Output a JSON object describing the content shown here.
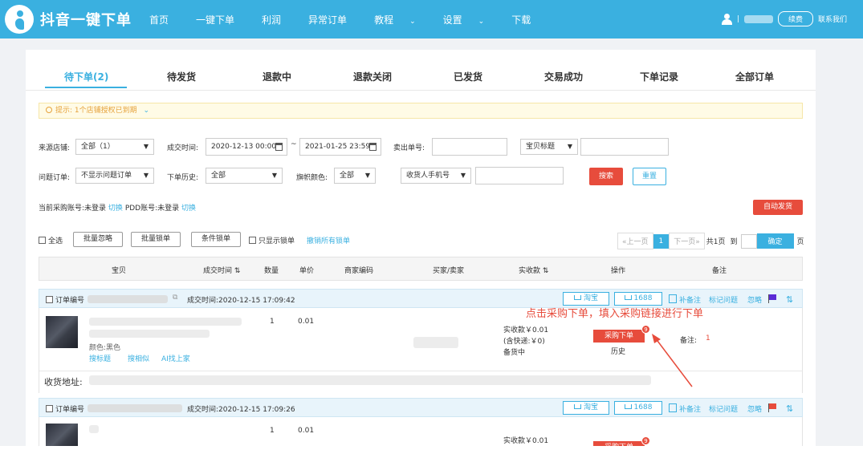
{
  "app": {
    "brand": "抖音一键下单"
  },
  "nav": [
    {
      "label": "首页",
      "dropdown": false
    },
    {
      "label": "一键下单",
      "dropdown": false
    },
    {
      "label": "利润",
      "dropdown": false
    },
    {
      "label": "异常订单",
      "dropdown": false
    },
    {
      "label": "教程",
      "dropdown": true
    },
    {
      "label": "设置",
      "dropdown": true
    },
    {
      "label": "下载",
      "dropdown": false
    }
  ],
  "user": {
    "separator": "|",
    "renew_label": "续费",
    "contact_label": "联系我们"
  },
  "tabs": [
    {
      "label": "待下单(2)",
      "active": true
    },
    {
      "label": "待发货",
      "active": false
    },
    {
      "label": "退款中",
      "active": false
    },
    {
      "label": "退款关闭",
      "active": false
    },
    {
      "label": "已发货",
      "active": false
    },
    {
      "label": "交易成功",
      "active": false
    },
    {
      "label": "下单记录",
      "active": false
    },
    {
      "label": "全部订单",
      "active": false
    }
  ],
  "tip": {
    "prefix": "提示:",
    "text": "1个店铺授权已到期"
  },
  "filters": {
    "shop_label": "来源店铺:",
    "shop_value": "全部（1）",
    "time_label": "成交时间:",
    "time_start": "2020-12-13 00:00",
    "time_sep": "~",
    "time_end": "2021-01-25 23:59",
    "sell_no_label": "卖出单号:",
    "title_select": "宝贝标题",
    "issue_label": "问题订单:",
    "issue_value": "不显示问题订单",
    "history_label": "下单历史:",
    "history_value": "全部",
    "flag_label": "旗帜颜色:",
    "flag_value": "全部",
    "phone_select": "收货人手机号",
    "search_label": "搜索",
    "reset_label": "重置"
  },
  "account": {
    "purchase_label": "当前采购账号:未登录",
    "switch1": "切换",
    "pdd_label": "PDD账号:未登录",
    "switch2": "切换",
    "auto_ship": "自动发货"
  },
  "bulk": {
    "select_all": "全选",
    "ignore": "批量忽略",
    "lock": "批量锁单",
    "cond_lock": "条件锁单",
    "only_locked": "只显示锁单",
    "unlock_all": "撤销所有锁单"
  },
  "pager": {
    "prev": "«上一页",
    "current": "1",
    "next": "下一页»",
    "total": "共1页",
    "goto": "到",
    "ok": "确定",
    "unit": "页"
  },
  "columns": [
    {
      "label": "宝贝"
    },
    {
      "label": "成交时间 ⇅"
    },
    {
      "label": "数量"
    },
    {
      "label": "单价"
    },
    {
      "label": "商家编码"
    },
    {
      "label": "买家/卖家"
    },
    {
      "label": "实收款 ⇅"
    },
    {
      "label": "操作"
    },
    {
      "label": "备注"
    }
  ],
  "orders": [
    {
      "order_no_label": "订单编号",
      "deal_time": "成交时间:2020-12-15 17:09:42",
      "taobao": "淘宝",
      "b1688": "1688",
      "supplement_note": "补备注",
      "mark_issue": "标记问题",
      "ignore": "忽略",
      "flag_color": "#5b2bd6",
      "qty": "1",
      "price": "0.01",
      "variant": "颜色:黑色",
      "search_title": "搜标题",
      "search_similar": "搜相似",
      "ai_find": "AI找上家",
      "received": "实收款￥0.01",
      "shipping": "(含快递:￥0)",
      "status": "备货中",
      "buy_label": "采购下单",
      "badge": "9",
      "history": "历史",
      "remark_label": "备注:",
      "remark_value": "1",
      "address_label": "收货地址:"
    },
    {
      "order_no_label": "订单编号",
      "deal_time": "成交时间:2020-12-15 17:09:26",
      "taobao": "淘宝",
      "b1688": "1688",
      "supplement_note": "补备注",
      "mark_issue": "标记问题",
      "ignore": "忽略",
      "flag_color": "#e74c3c",
      "qty": "1",
      "price": "0.01",
      "received": "实收款￥0.01",
      "buy_label": "采购下单",
      "badge": "9"
    }
  ],
  "annotation": "点击采购下单，填入采购链接进行下单",
  "colors": {
    "primary": "#3ab0e0",
    "danger": "#e74c3c",
    "tip": "#e6a23c"
  }
}
